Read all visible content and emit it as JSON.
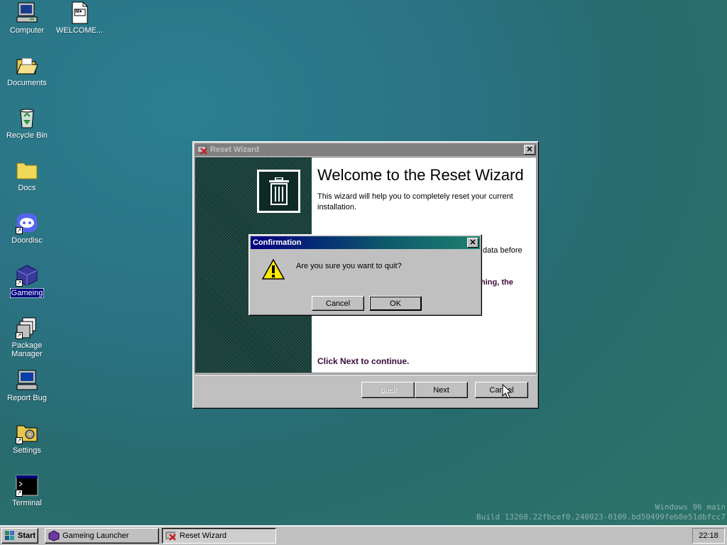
{
  "desktop": {
    "icons": [
      {
        "label": "Computer"
      },
      {
        "label": "WELCOME..."
      },
      {
        "label": "Documents"
      },
      {
        "label": "Recycle Bin"
      },
      {
        "label": "Docs"
      },
      {
        "label": "Doordisc"
      },
      {
        "label": "Gameing"
      },
      {
        "label": "Package Manager"
      },
      {
        "label": "Report Bug"
      },
      {
        "label": "Settings"
      },
      {
        "label": "Terminal"
      }
    ],
    "welcome_icon_text": "M♦",
    "watermark": {
      "line1": "Windows 96 main",
      "line2": "Build 13268.22fbcef0.240923-0109.bd50499feb8e51dbfcc7"
    }
  },
  "wizard": {
    "title": "Reset Wizard",
    "heading": "Welcome to the Reset Wizard",
    "para1": "This wizard will help you to completely reset your current installation.",
    "para2_fragment": "data before",
    "para3_fragment": "hing, the",
    "continue_text": "Click Next to continue.",
    "buttons": {
      "back": "Back",
      "next": "Next",
      "cancel": "Cancel"
    },
    "icon": "trash-icon"
  },
  "confirm": {
    "title": "Confirmation",
    "message": "Are you sure you want to quit?",
    "icon": "warning-icon",
    "buttons": {
      "cancel": "Cancel",
      "ok": "OK"
    }
  },
  "taskbar": {
    "start_label": "Start",
    "tasks": [
      {
        "label": "Gameing Launcher",
        "icon": "cube-icon"
      },
      {
        "label": "Reset Wizard",
        "icon": "reset-icon"
      }
    ],
    "clock": "22:18"
  },
  "colors": {
    "title_active_start": "#000080",
    "title_active_end": "#1e8070",
    "continue_text": "#3b0a3b"
  }
}
